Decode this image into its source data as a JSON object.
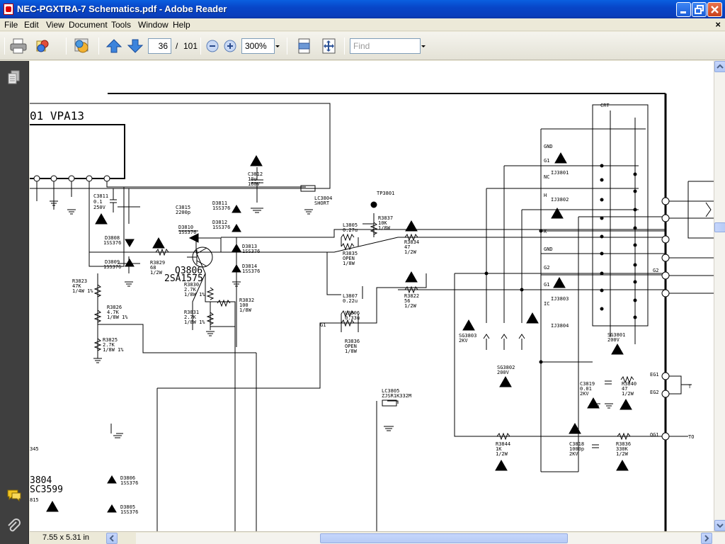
{
  "window": {
    "title": "NEC-PGXTRA-7 Schematics.pdf - Adobe Reader",
    "controls": [
      "minimize",
      "maximize",
      "close"
    ]
  },
  "menu": {
    "items": [
      "File",
      "Edit",
      "View",
      "Document",
      "Tools",
      "Window",
      "Help"
    ],
    "doc_close": "×"
  },
  "toolbar": {
    "page_current": "36",
    "page_separator": "/",
    "page_total": "101",
    "zoom": "300%",
    "find_placeholder": "Find",
    "icons": [
      "print-icon",
      "organize-icon",
      "collaborate-icon",
      "previous-page-icon",
      "next-page-icon",
      "zoom-out-icon",
      "zoom-in-icon",
      "fit-width-icon",
      "full-screen-icon"
    ]
  },
  "status": {
    "page_size": "7.55 x 5.31 in"
  },
  "schematic": {
    "labels": [
      "01 VPA13",
      "C3811",
      "0.1",
      "250V",
      "D3808",
      "1SS376",
      "D3809",
      "1SS376",
      "R3823",
      "47K",
      "1/4W 1%",
      "R3829",
      "68",
      "1/2W",
      "C3815",
      "2200p",
      "D3810",
      "1SS376",
      "Q3806",
      "2SA1575",
      "R3830",
      "2.7K",
      "1/8W 1%",
      "R3826",
      "4.7K",
      "1/8W 1%",
      "R3825",
      "2.7K",
      "1/8W 1%",
      "R3831",
      "2.7K",
      "1/8W 1%",
      "R3832",
      "100",
      "1/8W",
      "C3812",
      "10u",
      "160V",
      "D3811",
      "1SS376",
      "D3812",
      "1SS376",
      "D3813",
      "1SS376",
      "D3814",
      "1SS376",
      "LC3804",
      "SHORT",
      "TP3801",
      "R3837",
      "10K",
      "1/8W",
      "L3805",
      "0.27u",
      "R3835",
      "OPEN",
      "1/8W",
      "R3834",
      "47",
      "1/2W",
      "L3807",
      "0.22u",
      "L3806",
      "0.33u",
      "R3836",
      "OPEN",
      "1/8W",
      "R3822",
      "56",
      "1/2W",
      "LC3805",
      "ZJSR1K332M",
      "SG3803",
      "2KV",
      "SG3802",
      "200V",
      "SG3801",
      "200V",
      "C3819",
      "0.01",
      "2KV",
      "R3840",
      "47",
      "1/2W",
      "R3844",
      "1K",
      "1/2W",
      "C3818",
      "1000p",
      "2KV",
      "R3836",
      "330K",
      "1/2W",
      "IJ3801",
      "IJ3802",
      "IJ3803",
      "IJ3804",
      "GND",
      "G1",
      "NC",
      "H",
      "K",
      "GND",
      "G2",
      "G1",
      "IC",
      "CRT",
      "EG1",
      "EG2",
      "QG1",
      "D3806",
      "1SS376",
      "D3805",
      "1SS376",
      "3804",
      "SC3599",
      "815",
      "345",
      "G1",
      "G2",
      "T",
      "TO"
    ]
  }
}
